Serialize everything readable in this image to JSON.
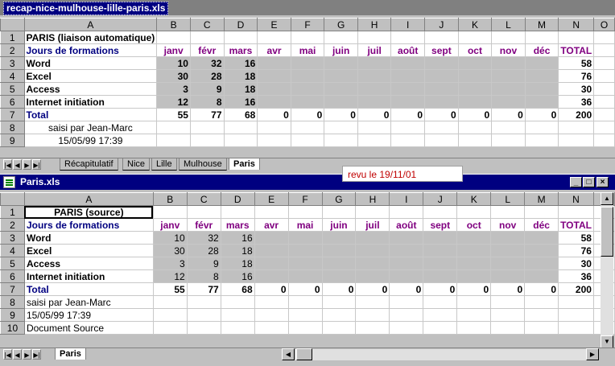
{
  "window1": {
    "title": "recap-nice-mulhouse-lille-paris.xls",
    "row1_title": "PARIS (liaison automatique)",
    "saisi": "saisi par Jean-Marc",
    "date": "15/05/99 17:39",
    "tabs": [
      "Récapitulatif",
      "Nice",
      "Lille",
      "Mulhouse",
      "Paris"
    ],
    "active_tab": "Paris"
  },
  "window2": {
    "title": "Paris.xls",
    "row1_title": "PARIS (source)",
    "saisi": "saisi par Jean-Marc",
    "date": "15/05/99 17:39",
    "doc_source": "Document Source",
    "tabs": [
      "Paris"
    ],
    "active_tab": "Paris"
  },
  "note": "revu le 19/11/01",
  "columns": [
    "A",
    "B",
    "C",
    "D",
    "E",
    "F",
    "G",
    "H",
    "I",
    "J",
    "K",
    "L",
    "M",
    "N",
    "O"
  ],
  "table": {
    "header_label": "Jours de formations",
    "months": [
      "janv",
      "févr",
      "mars",
      "avr",
      "mai",
      "juin",
      "juil",
      "août",
      "sept",
      "oct",
      "nov",
      "déc"
    ],
    "total_label": "TOTAL",
    "rows": [
      {
        "label": "Word",
        "values": [
          "10",
          "32",
          "16"
        ],
        "total": "58"
      },
      {
        "label": "Excel",
        "values": [
          "30",
          "28",
          "18"
        ],
        "total": "76"
      },
      {
        "label": "Access",
        "values": [
          "3",
          "9",
          "18"
        ],
        "total": "30"
      },
      {
        "label": "Internet initiation",
        "values": [
          "12",
          "8",
          "16"
        ],
        "total": "36"
      }
    ],
    "total_row": {
      "label": "Total",
      "values": [
        "55",
        "77",
        "68",
        "0",
        "0",
        "0",
        "0",
        "0",
        "0",
        "0",
        "0",
        "0"
      ],
      "total": "200"
    }
  },
  "colors": {
    "title_active": "#000080",
    "purple": "#800080",
    "note_red": "#c00000"
  }
}
